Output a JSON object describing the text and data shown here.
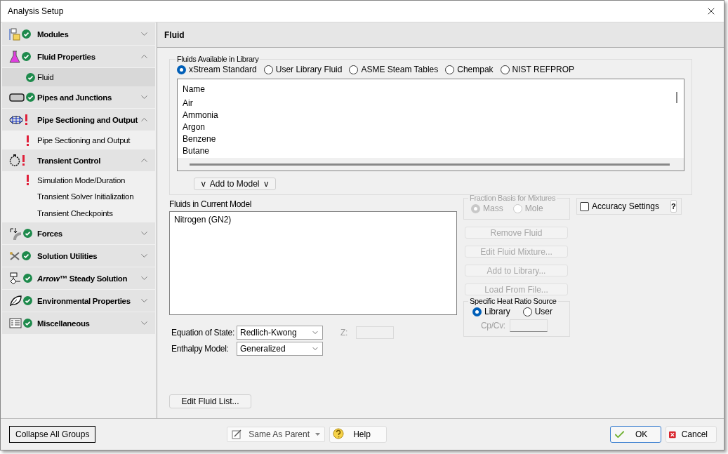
{
  "window": {
    "title": "Analysis Setup"
  },
  "sidebar": {
    "groups": [
      {
        "label": "Modules",
        "complete": true,
        "warning": false,
        "expanded": false
      },
      {
        "label": "Fluid Properties",
        "complete": true,
        "warning": false,
        "expanded": true,
        "children": [
          {
            "label": "Fluid",
            "complete": true,
            "warning": false,
            "selected": true
          }
        ]
      },
      {
        "label": "Pipes and Junctions",
        "complete": true,
        "warning": false,
        "expanded": false
      },
      {
        "label": "Pipe Sectioning and Output",
        "complete": false,
        "warning": true,
        "expanded": true,
        "children": [
          {
            "label": "Pipe Sectioning and Output",
            "complete": false,
            "warning": true,
            "selected": false
          }
        ]
      },
      {
        "label": "Transient Control",
        "complete": false,
        "warning": true,
        "expanded": true,
        "children": [
          {
            "label": "Simulation Mode/Duration",
            "complete": false,
            "warning": true,
            "selected": false
          },
          {
            "label": "Transient Solver Initialization",
            "complete": false,
            "warning": false,
            "selected": false
          },
          {
            "label": "Transient Checkpoints",
            "complete": false,
            "warning": false,
            "selected": false
          }
        ]
      },
      {
        "label": "Forces",
        "complete": true,
        "warning": false,
        "expanded": false
      },
      {
        "label": "Solution Utilities",
        "complete": true,
        "warning": false,
        "expanded": false
      },
      {
        "label": "*Arrow*™ Steady Solution",
        "complete": true,
        "warning": false,
        "expanded": false
      },
      {
        "label": "Environmental Properties",
        "complete": true,
        "warning": false,
        "expanded": false
      },
      {
        "label": "Miscellaneous",
        "complete": true,
        "warning": false,
        "expanded": false
      }
    ]
  },
  "panel": {
    "title": "Fluid",
    "library": {
      "legend": "Fluids Available in Library",
      "sources": [
        {
          "label": "xStream Standard",
          "selected": true
        },
        {
          "label": "User Library Fluid",
          "selected": false
        },
        {
          "label": "ASME Steam Tables",
          "selected": false
        },
        {
          "label": "Chempak",
          "selected": false
        },
        {
          "label": "NIST REFPROP",
          "selected": false
        }
      ],
      "column": "Name",
      "items": [
        "Air",
        "Ammonia",
        "Argon",
        "Benzene",
        "Butane"
      ],
      "add_button": "v  Add to Model  v"
    },
    "current_model": {
      "label": "Fluids in Current Model",
      "items": [
        "Nitrogen (GN2)"
      ]
    },
    "equation_of_state": {
      "label": "Equation of State:",
      "value": "Redlich-Kwong"
    },
    "z_field": {
      "label": "Z:",
      "disabled": true
    },
    "enthalpy_model": {
      "label": "Enthalpy Model:",
      "value": "Generalized"
    },
    "fraction_basis": {
      "legend": "Fraction Basis for Mixtures",
      "disabled": true,
      "options": [
        {
          "label": "Mass",
          "selected": true
        },
        {
          "label": "Mole",
          "selected": false
        }
      ]
    },
    "actions": [
      {
        "label": "Remove Fluid",
        "disabled": true
      },
      {
        "label": "Edit Fluid Mixture...",
        "disabled": true
      },
      {
        "label": "Add to Library...",
        "disabled": true
      },
      {
        "label": "Load From File...",
        "disabled": true
      }
    ],
    "heat_ratio": {
      "legend": "Specific Heat Ratio Source",
      "options": [
        {
          "label": "Library",
          "selected": true
        },
        {
          "label": "User",
          "selected": false
        }
      ],
      "cp_label": "Cp/Cv:",
      "cp_disabled": true
    },
    "accuracy": {
      "label": "Accuracy Settings",
      "checked": false,
      "help": "?"
    },
    "edit_list_button": "Edit Fluid List..."
  },
  "footer": {
    "collapse_button": "Collapse All Groups",
    "parent_select": "Same As Parent",
    "help_button": "Help",
    "ok_button": "OK",
    "cancel_button": "Cancel"
  }
}
